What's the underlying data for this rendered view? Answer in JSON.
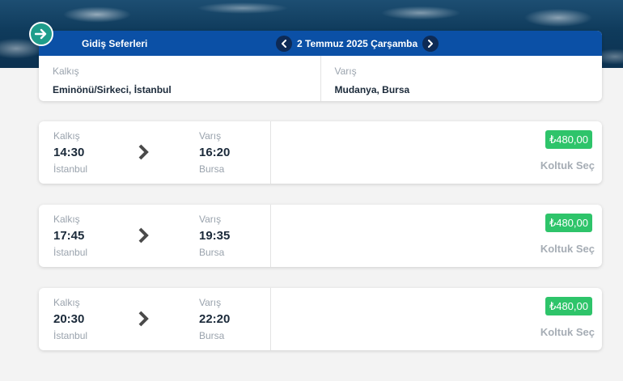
{
  "header": {
    "title": "Gidiş Seferleri",
    "date": "2 Temmuz 2025 Çarşamba"
  },
  "route": {
    "from_label": "Kalkış",
    "from_value": "Eminönü/Sirkeci, İstanbul",
    "to_label": "Varış",
    "to_value": "Mudanya, Bursa"
  },
  "trips": [
    {
      "dep_label": "Kalkış",
      "dep_time": "14:30",
      "dep_city": "İstanbul",
      "arr_label": "Varış",
      "arr_time": "16:20",
      "arr_city": "Bursa",
      "price": "₺480,00",
      "action": "Koltuk Seç"
    },
    {
      "dep_label": "Kalkış",
      "dep_time": "17:45",
      "dep_city": "İstanbul",
      "arr_label": "Varış",
      "arr_time": "19:35",
      "arr_city": "Bursa",
      "price": "₺480,00",
      "action": "Koltuk Seç"
    },
    {
      "dep_label": "Kalkış",
      "dep_time": "20:30",
      "dep_city": "İstanbul",
      "arr_label": "Varış",
      "arr_time": "22:20",
      "arr_city": "Bursa",
      "price": "₺480,00",
      "action": "Koltuk Seç"
    }
  ],
  "colors": {
    "header_blue": "#0b50a6",
    "price_green": "#2ec46a",
    "badge_teal": "#1f9d8b"
  },
  "icons": {
    "direction": "arrow-right-icon",
    "prev": "chevron-left-icon",
    "next": "chevron-right-icon",
    "trip": "chevron-right-icon"
  }
}
